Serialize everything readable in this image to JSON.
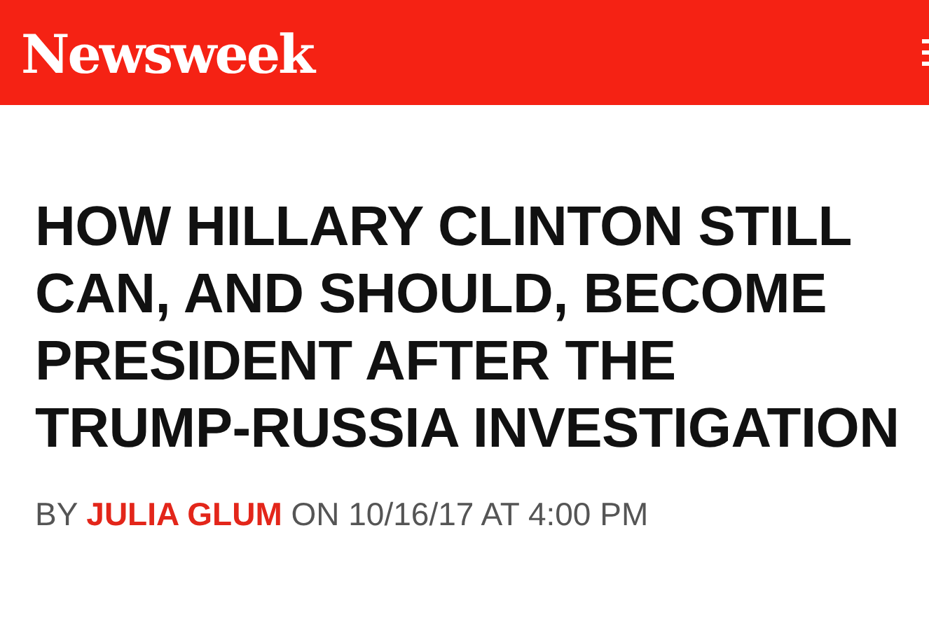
{
  "header": {
    "logo": "Newsweek"
  },
  "article": {
    "headline": "HOW HILLARY CLINTON STILL CAN, AND SHOULD, BECOME PRESIDENT AFTER THE TRUMP-RUSSIA INVESTIGATION",
    "byline": {
      "prefix": "BY",
      "author": "JULIA GLUM",
      "date": "ON 10/16/17 AT 4:00 PM"
    }
  }
}
